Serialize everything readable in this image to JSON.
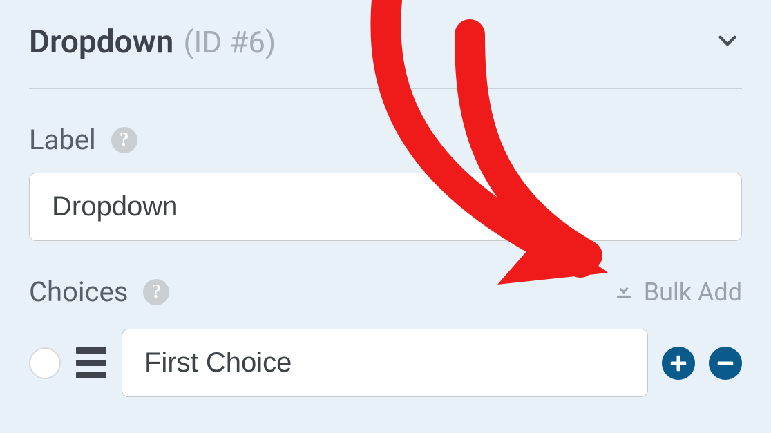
{
  "header": {
    "name": "Dropdown",
    "id_label": "(ID #6)"
  },
  "label_section": {
    "title": "Label",
    "value": "Dropdown"
  },
  "choices_section": {
    "title": "Choices",
    "bulk_add_label": "Bulk Add",
    "items": [
      {
        "value": "First Choice"
      }
    ]
  },
  "colors": {
    "button": "#0a5a8c",
    "annotation": "#ef1b1b"
  }
}
